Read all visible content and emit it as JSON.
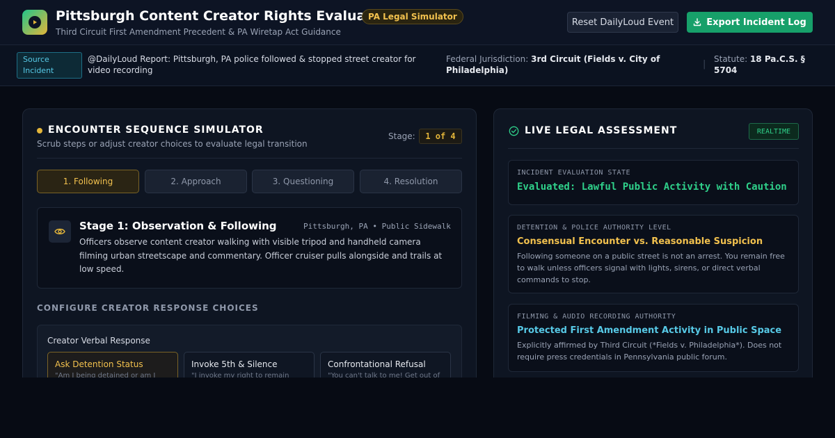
{
  "header": {
    "title": "Pittsburgh Content Creator Rights Evaluator",
    "badge": "PA Legal Simulator",
    "subtitle": "Third Circuit First Amendment Precedent & PA Wiretap Act Guidance",
    "reset_label": "Reset DailyLoud Event",
    "export_label": "Export Incident Log",
    "logo_icon": "play-icon",
    "export_icon": "download-icon"
  },
  "incident_bar": {
    "badge": "Source Incident",
    "text": "@DailyLoud Report: Pittsburgh, PA police followed & stopped street creator for video recording",
    "jurisdiction_label": "Federal Jurisdiction:",
    "jurisdiction_value": "3rd Circuit (Fields v. City of Philadelphia)",
    "statute_label": "Statute:",
    "statute_value": "18 Pa.C.S. § 5704"
  },
  "simulator": {
    "title": "ENCOUNTER SEQUENCE SIMULATOR",
    "subtitle": "Scrub steps or adjust creator choices to evaluate legal transition",
    "stage_label": "Stage:",
    "stage_value": "1 of 4",
    "tabs": [
      {
        "label": "1. Following"
      },
      {
        "label": "2. Approach"
      },
      {
        "label": "3. Questioning"
      },
      {
        "label": "4. Resolution"
      }
    ],
    "active_tab": 0,
    "stage_card": {
      "icon": "eye-icon",
      "title": "Stage 1: Observation & Following",
      "location": "Pittsburgh, PA • Public Sidewalk",
      "description": "Officers observe content creator walking with visible tripod and handheld camera filming urban streetscape and commentary. Officer cruiser pulls alongside and trails at low speed."
    },
    "config_title": "CONFIGURE CREATOR RESPONSE CHOICES",
    "verbal": {
      "label": "Creator Verbal Response",
      "options": [
        {
          "title": "Ask Detention Status",
          "sub": "\"Am I being detained or am I"
        },
        {
          "title": "Invoke 5th & Silence",
          "sub": "\"I invoke my right to remain"
        },
        {
          "title": "Confrontational Refusal",
          "sub": "\"You can't talk to me! Get out of"
        }
      ],
      "selected": 0
    }
  },
  "assessment": {
    "title": "LIVE LEGAL ASSESSMENT",
    "badge": "REALTIME",
    "title_icon": "check-circle-icon",
    "state_card": {
      "label": "INCIDENT EVALUATION STATE",
      "value": "Evaluated: Lawful Public Activity with Caution"
    },
    "detention_card": {
      "label": "DETENTION & POLICE AUTHORITY LEVEL",
      "heading": "Consensual Encounter vs. Reasonable Suspicion",
      "description": "Following someone on a public street is not an arrest. You remain free to walk unless officers signal with lights, sirens, or direct verbal commands to stop."
    },
    "filming_card": {
      "label": "FILMING & AUDIO RECORDING AUTHORITY",
      "heading": "Protected First Amendment Activity in Public Space",
      "description": "Explicitly affirmed by Third Circuit (*Fields v. Philadelphia*). Does not require press credentials in Pennsylvania public forum."
    }
  },
  "colors": {
    "accent_gold": "#e3b53a",
    "accent_green": "#17a06a",
    "status_green": "#2fd08a",
    "detention_heading": "#f2c14e",
    "filming_heading": "#57c9e6"
  }
}
